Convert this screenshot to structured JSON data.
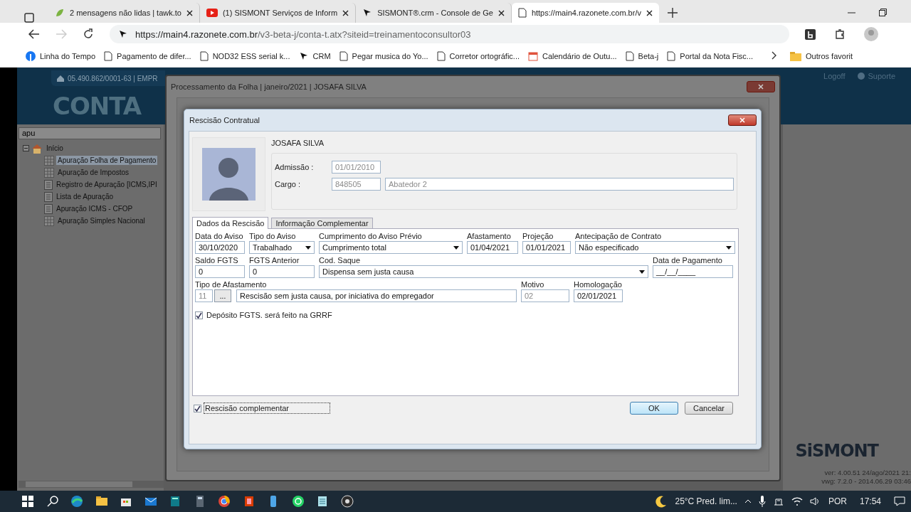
{
  "browser": {
    "tabs": [
      {
        "title": "2 mensagens não lidas | tawk.to",
        "selected": false,
        "kind": "chat"
      },
      {
        "title": "(1) SISMONT Serviços de Inform",
        "selected": false,
        "kind": "video"
      },
      {
        "title": "SISMONT®.crm - Console de Ge",
        "selected": false,
        "kind": "crm"
      },
      {
        "title": "https://main4.razonete.com.br/v",
        "selected": true,
        "kind": "page"
      }
    ],
    "url_host": "https://main4.razonete.com.br",
    "url_path": "/v3-beta-j/conta-t.atx?siteid=treinamentoconsultor03",
    "bookmarks": [
      {
        "label": "Linha do Tempo",
        "kind": "social"
      },
      {
        "label": "Pagamento de difer...",
        "kind": "page"
      },
      {
        "label": "NOD32 ESS serial k...",
        "kind": "page"
      },
      {
        "label": "CRM",
        "kind": "crm"
      },
      {
        "label": "Pegar musica do Yo...",
        "kind": "page"
      },
      {
        "label": "Corretor ortográfic...",
        "kind": "page"
      },
      {
        "label": "Calendário de Outu...",
        "kind": "calendar"
      },
      {
        "label": "Beta-j",
        "kind": "page"
      },
      {
        "label": "Portal da Nota Fisc...",
        "kind": "page"
      }
    ],
    "other_bookmarks": "Outros favorit"
  },
  "app": {
    "company": "05.490.862/0001-63 | EMPR",
    "logo": "CONTA",
    "logoff": "Logoff",
    "support": "Suporte",
    "search": {
      "value": "apu"
    },
    "tree": [
      {
        "label": "Início",
        "expanded": true,
        "selected": false,
        "children": [
          {
            "label": "Apuração Folha de Pagamento",
            "selected": true,
            "kind": "grid"
          },
          {
            "label": "Apuração de Impostos",
            "selected": false,
            "kind": "grid"
          },
          {
            "label": "Registro de Apuração [ICMS,IPI",
            "selected": false,
            "kind": "doc"
          },
          {
            "label": "Lista de Apuração",
            "selected": false,
            "kind": "doc"
          },
          {
            "label": "Apuração ICMS - CFOP",
            "selected": false,
            "kind": "doc"
          },
          {
            "label": "Apuração Simples Nacional",
            "selected": false,
            "kind": "grid"
          }
        ]
      }
    ],
    "brand": "SiSMONT",
    "version": "ver: 4.00.51 24/ago/2021 21:",
    "vwg": "vwg: 7.2.0 - 2014.06.29 03:46"
  },
  "outer_dialog": {
    "title": "Processamento da Folha | janeiro/2021 | JOSAFA SILVA"
  },
  "dialog": {
    "title": "Rescisão Contratual",
    "employee": "JOSAFA SILVA",
    "info": [
      {
        "label": "Admissão :",
        "fields": [
          {
            "value": "01/01/2010",
            "disabled": true
          }
        ]
      },
      {
        "label": "Cargo :",
        "fields": [
          {
            "value": "848505",
            "disabled": true
          },
          {
            "value": "Abatedor 2",
            "disabled": true
          }
        ]
      }
    ],
    "tabs": [
      {
        "label": "Dados da Rescisão",
        "selected": true
      },
      {
        "label": "Informação Complementar",
        "selected": false
      }
    ],
    "form_rows": [
      [
        {
          "label": "Data do Aviso",
          "value": "30/10/2020",
          "kind": "text",
          "disabled": false
        },
        {
          "label": "Tipo do Aviso",
          "value": "Trabalhado",
          "kind": "select",
          "disabled": false
        },
        {
          "label": "Cumprimento do Aviso Prévio",
          "value": "Cumprimento total",
          "kind": "select",
          "disabled": false
        },
        {
          "label": "Afastamento",
          "value": "01/04/2021",
          "kind": "text",
          "disabled": false
        },
        {
          "label": "Projeção",
          "value": "01/01/2021",
          "kind": "text",
          "disabled": false
        },
        {
          "label": "Antecipação de Contrato",
          "value": "Não especificado",
          "kind": "select",
          "disabled": false
        }
      ],
      [
        {
          "label": "Saldo FGTS",
          "value": "0",
          "kind": "text",
          "disabled": false
        },
        {
          "label": "FGTS Anterior",
          "value": "0",
          "kind": "text",
          "disabled": false
        },
        {
          "label": "Cod. Saque",
          "value": "Dispensa sem justa causa",
          "kind": "select",
          "disabled": false
        },
        {
          "label": "Data de Pagamento",
          "value": "__/__/____",
          "kind": "text",
          "disabled": false
        }
      ],
      [
        {
          "label": "Tipo de Afastamento",
          "value": "Rescisão sem justa causa, por iniciativa do empregador",
          "kind": "lookup",
          "code": "11",
          "button": "...",
          "disabled": true
        },
        {
          "label": "Motivo",
          "value": "02",
          "kind": "text",
          "disabled": true
        },
        {
          "label": "Homologação",
          "value": "02/01/2021",
          "kind": "text",
          "disabled": false
        }
      ]
    ],
    "deposit": {
      "label": "Depósito FGTS. será feito na GRRF",
      "checked": true
    },
    "complementary": {
      "label": "Rescisão complementar",
      "checked": true
    },
    "buttons": [
      {
        "label": "OK",
        "kind": "primary"
      },
      {
        "label": "Cancelar",
        "kind": "normal"
      }
    ]
  },
  "taskbar": {
    "weather": "25°C Pred. lim...",
    "language": "POR",
    "time": "17:54"
  }
}
